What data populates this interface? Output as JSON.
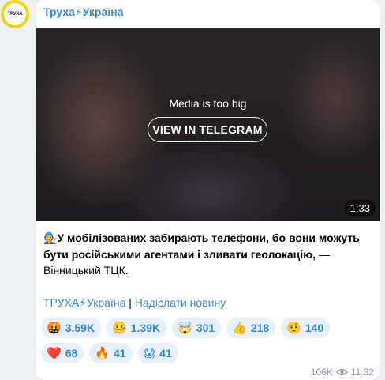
{
  "channel": {
    "avatar_text": "ТРУХА",
    "name": "Труха⚡Україна"
  },
  "media": {
    "title": "Media is too big",
    "button_label": "VIEW IN TELEGRAM",
    "duration": "1:33"
  },
  "post": {
    "emoji": "🧑‍🔧",
    "bold_text": "У мобілізованих забирають телефони, бо вони можуть бути російськими агентами і зливати геолокацію,",
    "plain_text": " — Вінницький ТЦК."
  },
  "links": {
    "channel_link": "ТРУХА⚡Україна",
    "separator": " | ",
    "submit_link": "Надіслати новину"
  },
  "reactions": [
    {
      "emoji": "🤬",
      "count": "3.59K"
    },
    {
      "emoji": "🤒",
      "count": "1.39K"
    },
    {
      "emoji": "🤯",
      "count": "301"
    },
    {
      "emoji": "👍",
      "count": "218"
    },
    {
      "emoji": "🤨",
      "count": "140"
    },
    {
      "emoji": "❤️",
      "count": "68"
    },
    {
      "emoji": "🔥",
      "count": "41"
    },
    {
      "emoji": "😱",
      "count": "41"
    }
  ],
  "meta": {
    "views": "106K",
    "time": "11:32"
  }
}
